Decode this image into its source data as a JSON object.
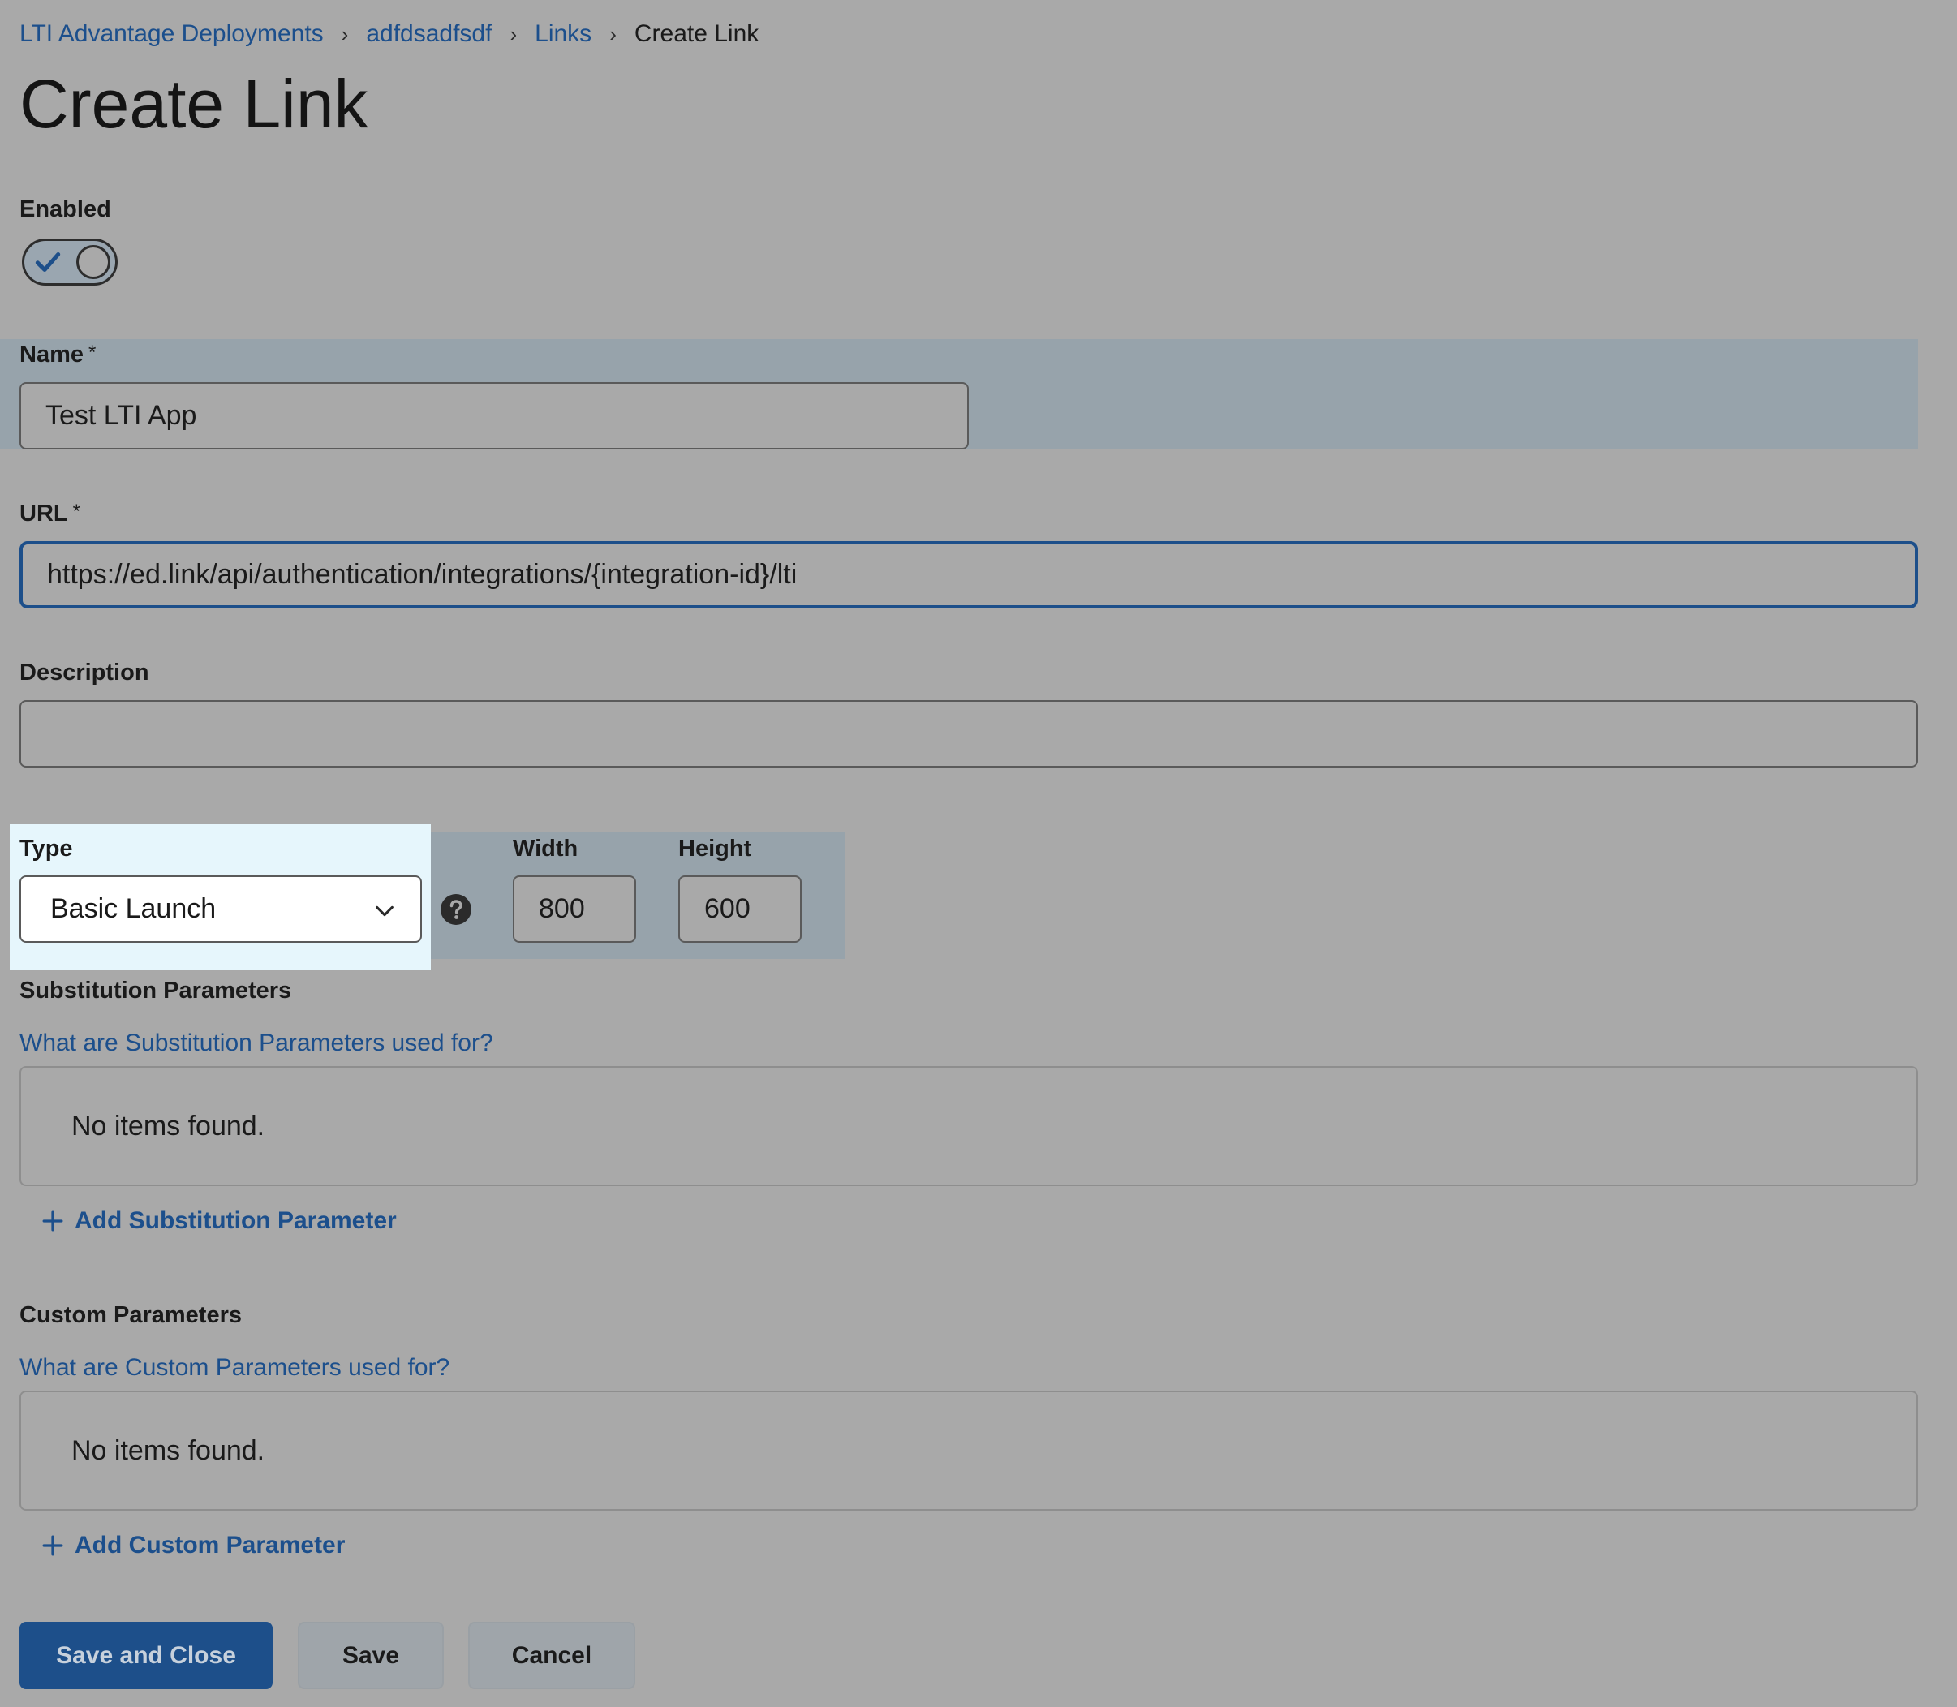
{
  "breadcrumb": {
    "items": [
      {
        "label": "LTI Advantage Deployments"
      },
      {
        "label": "adfdsadfsdf"
      },
      {
        "label": "Links"
      }
    ],
    "current": "Create Link",
    "separator": "›"
  },
  "page": {
    "title": "Create Link"
  },
  "enabled": {
    "label": "Enabled",
    "value": true
  },
  "name": {
    "label": "Name",
    "required_mark": "*",
    "value": "Test LTI App"
  },
  "url": {
    "label": "URL",
    "required_mark": "*",
    "value": "https://ed.link/api/authentication/integrations/{integration-id}/lti"
  },
  "description": {
    "label": "Description",
    "value": ""
  },
  "type": {
    "label": "Type",
    "selected": "Basic Launch"
  },
  "width": {
    "label": "Width",
    "value": "800"
  },
  "height": {
    "label": "Height",
    "value": "600"
  },
  "substitution": {
    "title": "Substitution Parameters",
    "help_link": "What are Substitution Parameters used for?",
    "empty_text": "No items found.",
    "add_label": "Add Substitution Parameter"
  },
  "custom": {
    "title": "Custom Parameters",
    "help_link": "What are Custom Parameters used for?",
    "empty_text": "No items found.",
    "add_label": "Add Custom Parameter"
  },
  "buttons": {
    "save_close": "Save and Close",
    "save": "Save",
    "cancel": "Cancel"
  },
  "colors": {
    "accent": "#1d4f8a",
    "link": "#1c4f8c",
    "overlay_bg": "#a9a9a9",
    "spotlight": "#e6f6fc"
  }
}
